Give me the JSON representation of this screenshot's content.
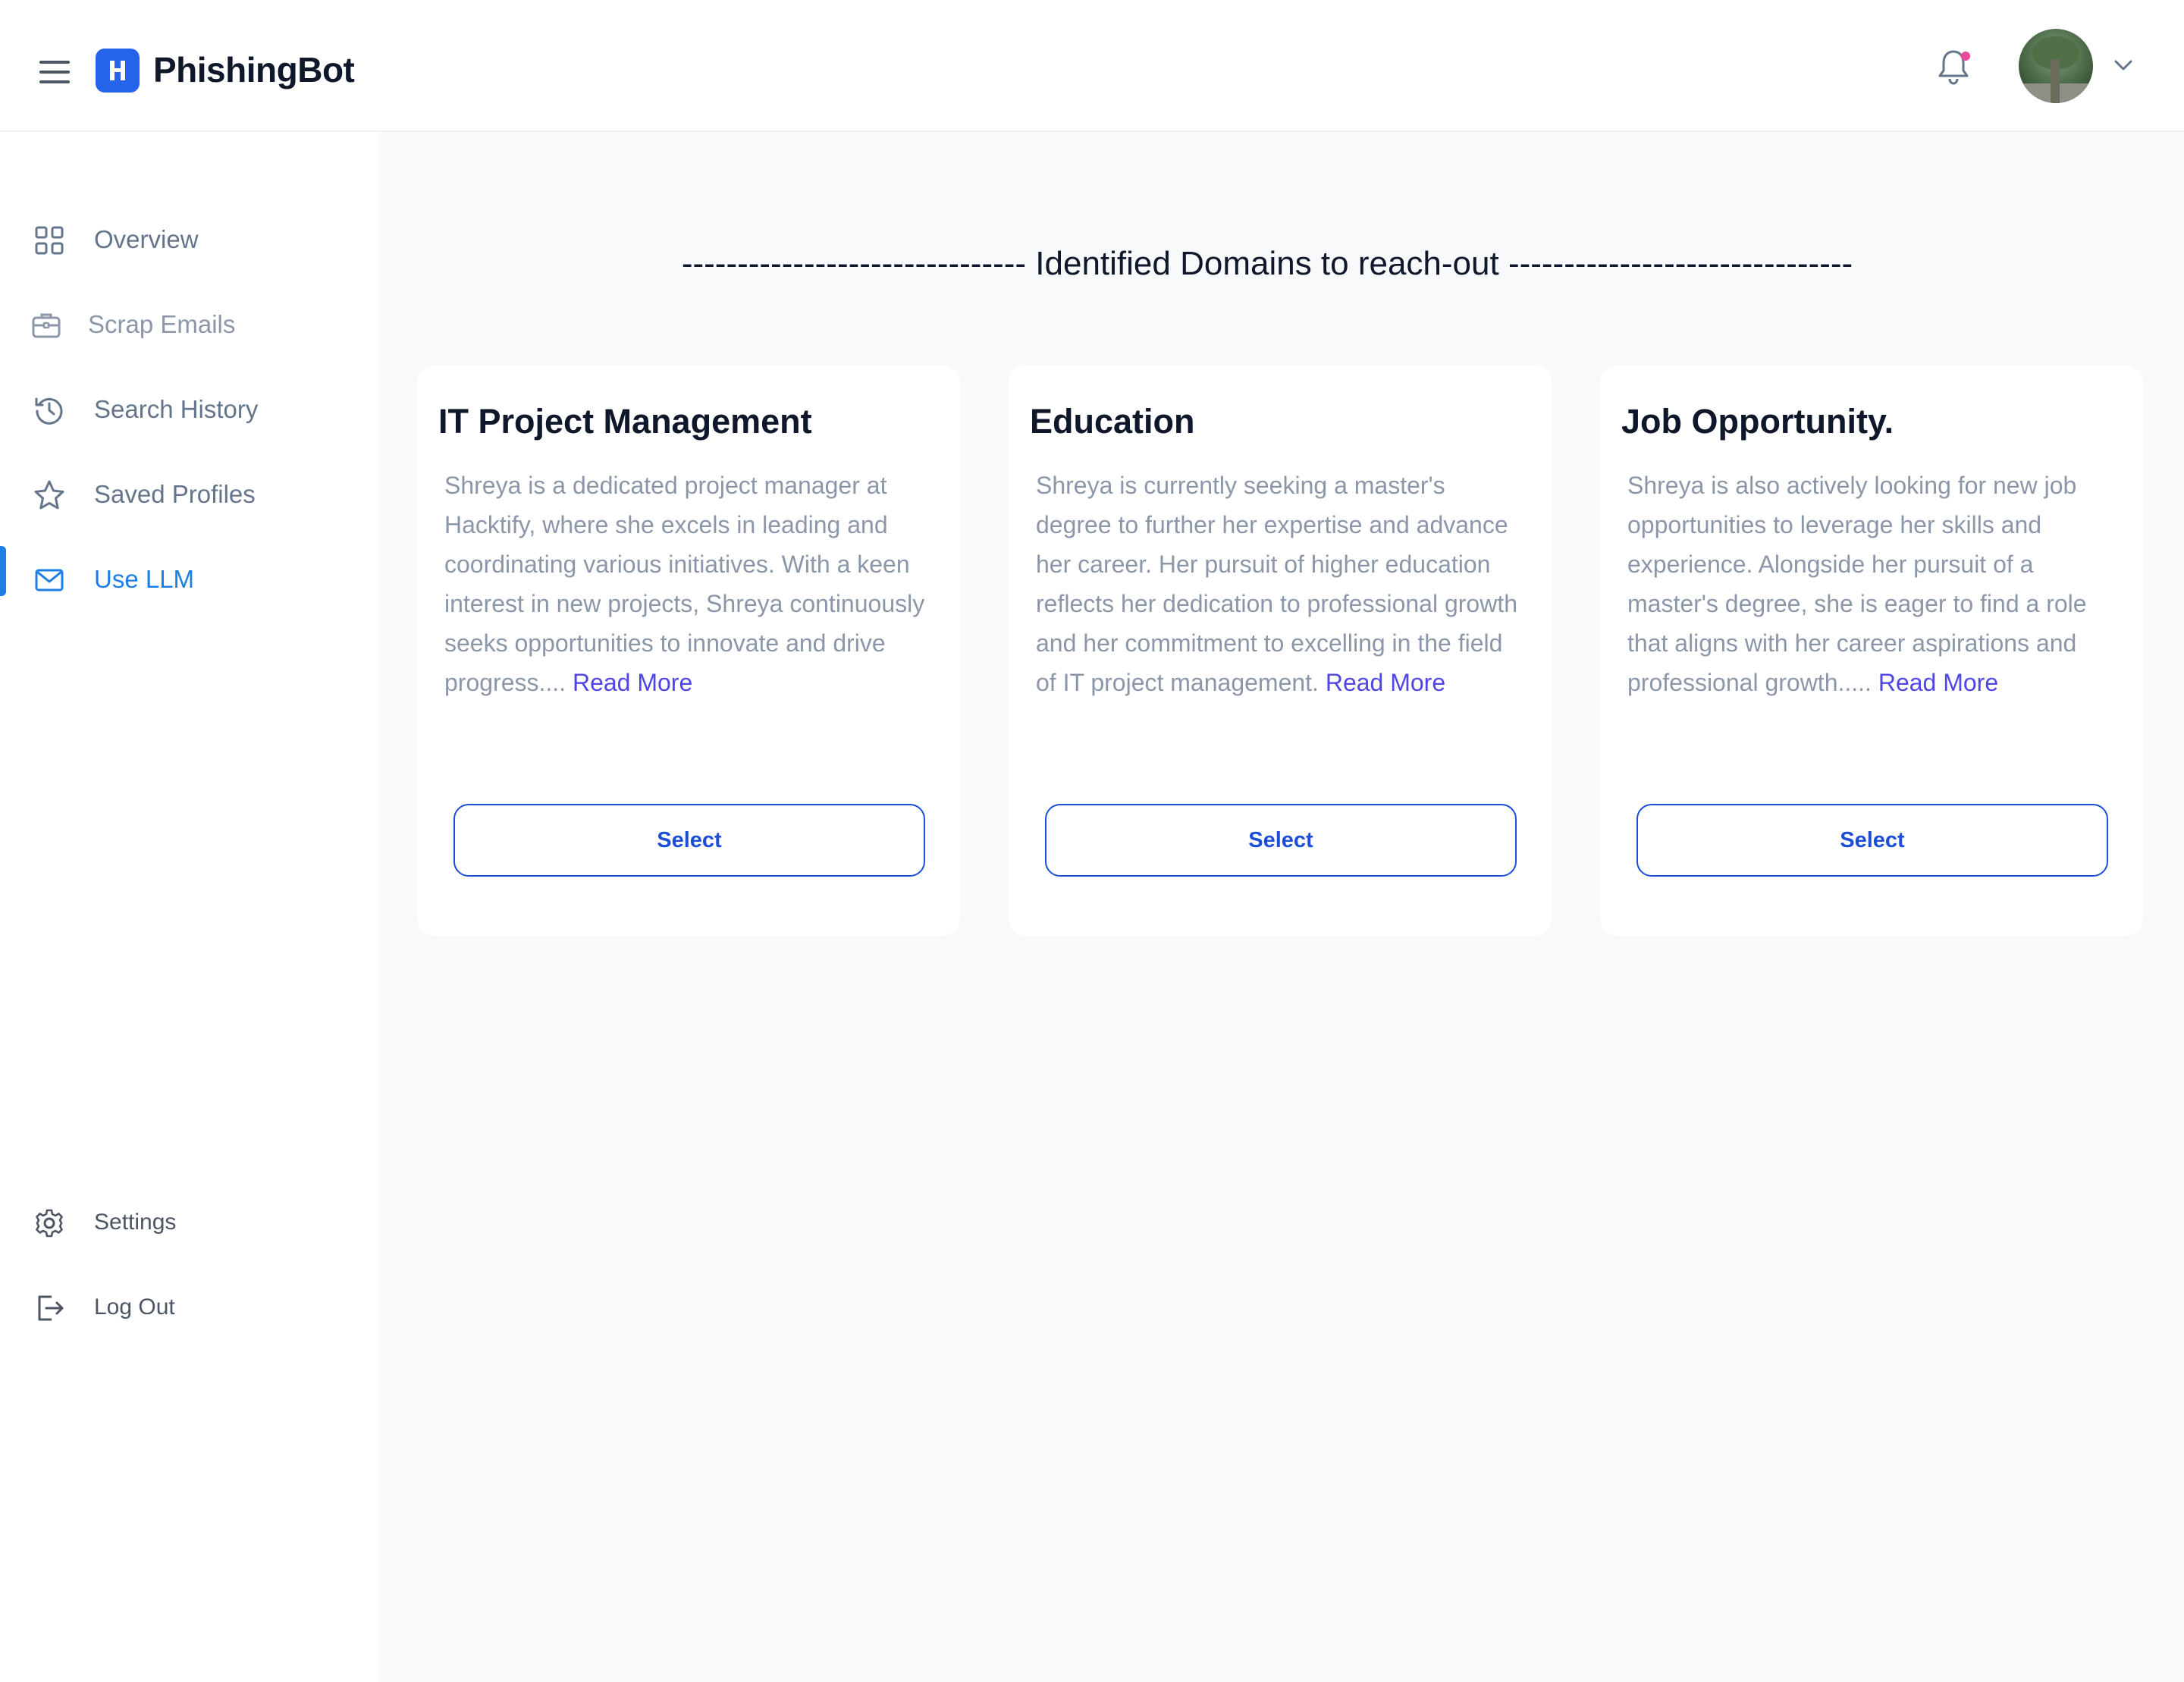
{
  "app": {
    "brand": "PhishingBot",
    "logo_letter": "H",
    "accent_color": "#2563eb",
    "active_color": "#1d7fe6"
  },
  "header": {
    "menu_icon": "hamburger-icon",
    "notification_icon": "bell-icon",
    "notification_dot_color": "#ec4899",
    "profile_dropdown_icon": "chevron-down-icon"
  },
  "sidebar": {
    "items": [
      {
        "label": "Overview",
        "icon": "grid-icon"
      },
      {
        "label": "Scrap Emails",
        "icon": "briefcase-icon"
      },
      {
        "label": "Search History",
        "icon": "history-icon"
      },
      {
        "label": "Saved Profiles",
        "icon": "star-icon"
      },
      {
        "label": "Use LLM",
        "icon": "mail-icon",
        "active": true
      }
    ],
    "bottom_items": [
      {
        "label": "Settings",
        "icon": "gear-icon"
      },
      {
        "label": "Log Out",
        "icon": "logout-icon"
      }
    ]
  },
  "main": {
    "heading": "------------------------------- Identified Domains to reach-out -------------------------------",
    "cards": [
      {
        "title": "IT Project Management",
        "description": "Shreya is a dedicated project manager at Hacktify, where she excels in leading and coordinating various initiatives. With a keen interest in new projects, Shreya continuously seeks opportunities to innovate and drive progress....",
        "read_more": "Read More",
        "button": "Select"
      },
      {
        "title": "Education",
        "description": "Shreya is currently seeking a master's degree to further her expertise and advance her career. Her pursuit of higher education reflects her dedication to professional growth and her commitment to excelling in the field of IT project management.",
        "read_more": "Read More",
        "button": "Select"
      },
      {
        "title": "Job Opportunity.",
        "description": "Shreya is also actively looking for new job opportunities to leverage her skills and experience. Alongside her pursuit of a master's degree, she is eager to find a role that aligns with her career aspirations and professional growth.....",
        "read_more": "Read More",
        "button": "Select"
      }
    ]
  }
}
